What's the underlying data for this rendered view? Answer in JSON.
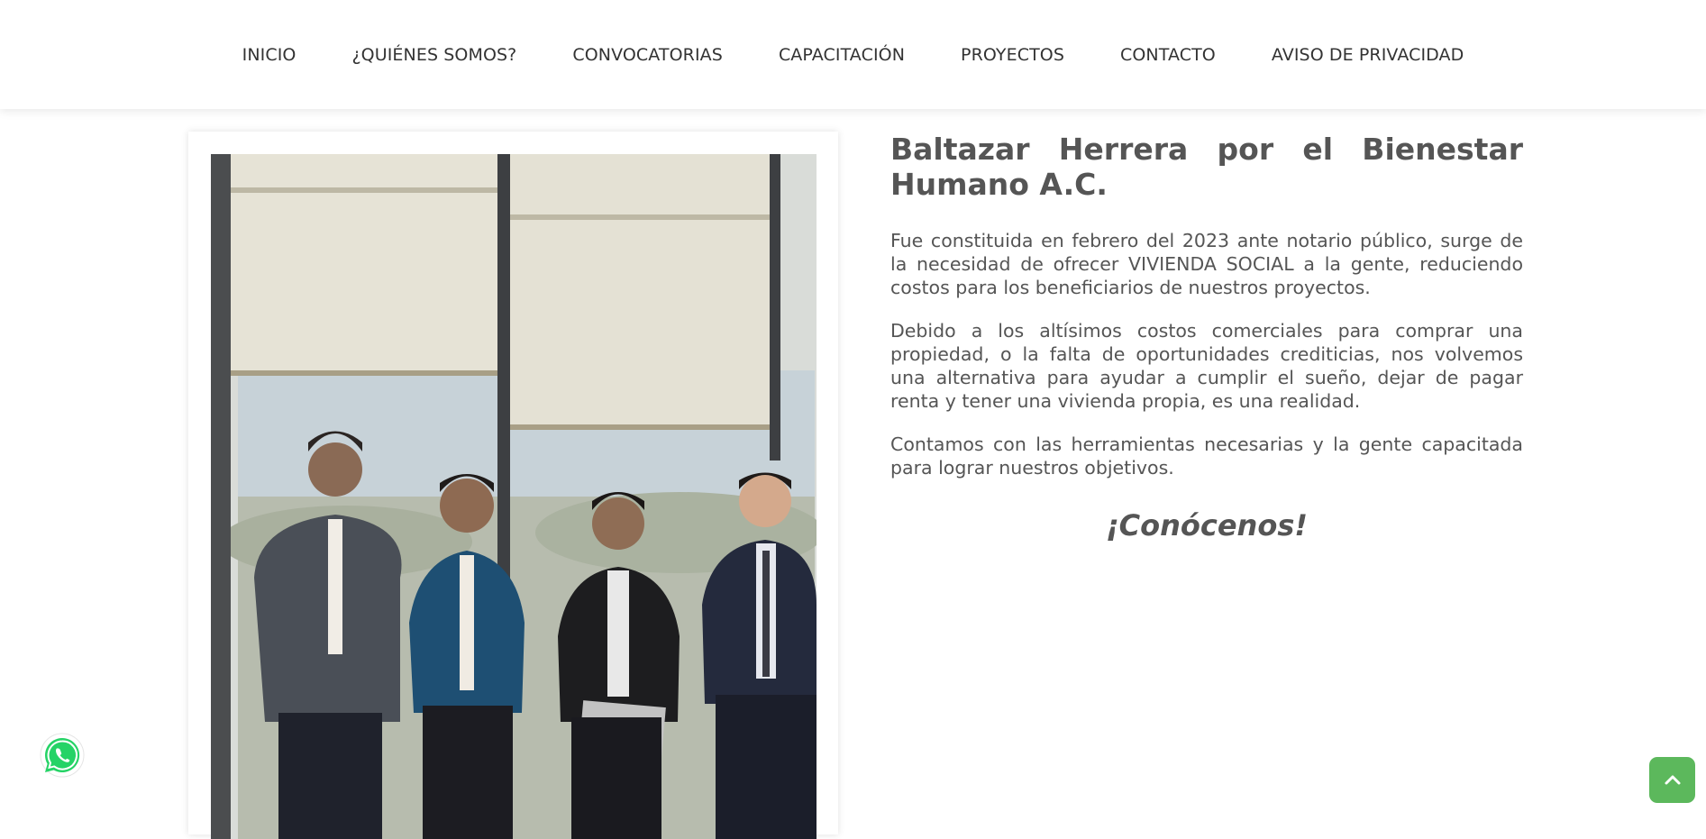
{
  "nav": {
    "items": [
      {
        "label": "INICIO"
      },
      {
        "label": "¿QUIÉNES SOMOS?"
      },
      {
        "label": "CONVOCATORIAS"
      },
      {
        "label": "CAPACITACIÓN"
      },
      {
        "label": "PROYECTOS"
      },
      {
        "label": "CONTACTO"
      },
      {
        "label": "AVISO DE PRIVACIDAD"
      }
    ]
  },
  "about": {
    "title": "Baltazar Herrera por el Bienestar Humano A.C.",
    "paragraphs": [
      "Fue constituida en febrero del 2023 ante notario público, surge de la necesidad de ofrecer VIVIENDA SOCIAL a la gente, reduciendo costos para los beneficiarios de nuestros proyectos.",
      "Debido a los altísimos costos comerciales para comprar una propiedad, o la falta de oportunidades crediticias, nos volvemos una alternativa para ayudar a cumplir el sueño, dejar de pagar renta y tener una vivienda propia, es una realidad.",
      "Contamos con las herramientas necesarias y la gente capacitada para lograr nuestros objetivos."
    ],
    "cta": "¡Conócenos!"
  },
  "icons": {
    "whatsapp": "whatsapp-icon",
    "scroll_top": "chevron-up-icon"
  },
  "colors": {
    "accent_green": "#5cb85c",
    "whatsapp_green": "#25d366",
    "text": "#555555"
  }
}
